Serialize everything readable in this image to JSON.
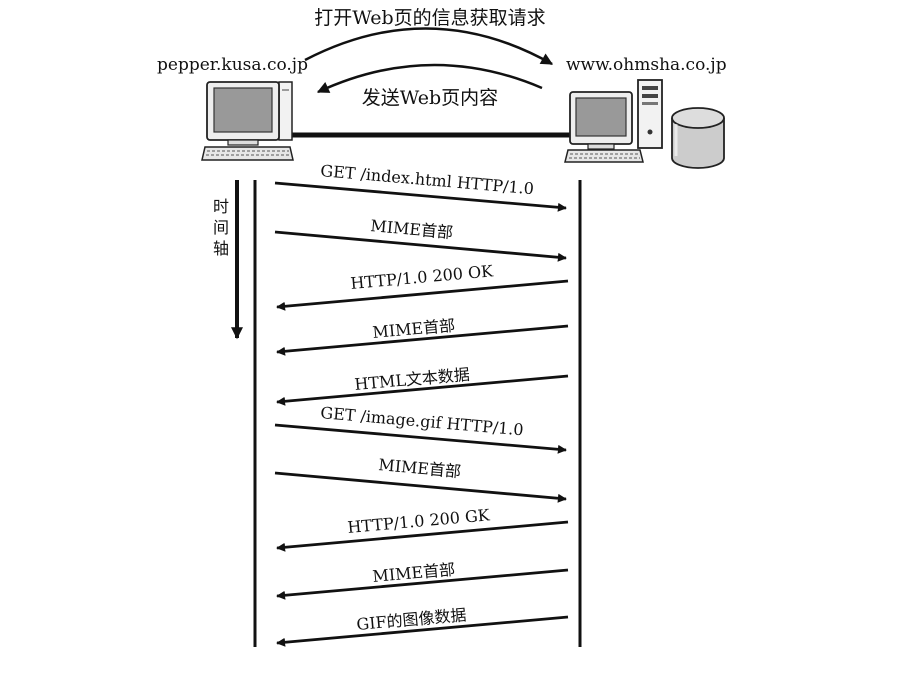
{
  "top": {
    "request_label": "打开Web页的信息获取请求",
    "response_label": "发送Web页内容"
  },
  "hosts": {
    "client": "pepper.kusa.co.jp",
    "server": "www.ohmsha.co.jp"
  },
  "timeline": {
    "label_chars": [
      "时",
      "间",
      "轴"
    ]
  },
  "messages": [
    {
      "label": "GET /index.html HTTP/1.0",
      "direction": "to-server"
    },
    {
      "label": "MIME首部",
      "direction": "to-server"
    },
    {
      "label": "HTTP/1.0 200 OK",
      "direction": "to-client"
    },
    {
      "label": "MIME首部",
      "direction": "to-client"
    },
    {
      "label": "HTML文本数据",
      "direction": "to-client"
    },
    {
      "label": "GET /image.gif  HTTP/1.0",
      "direction": "to-server"
    },
    {
      "label": "MIME首部",
      "direction": "to-server"
    },
    {
      "label": "HTTP/1.0 200 GK",
      "direction": "to-client"
    },
    {
      "label": "MIME首部",
      "direction": "to-client"
    },
    {
      "label": "GIF的图像数据",
      "direction": "to-client"
    }
  ],
  "colors": {
    "ink": "#111111",
    "screen": "#999999",
    "body": "#eeeeee"
  }
}
